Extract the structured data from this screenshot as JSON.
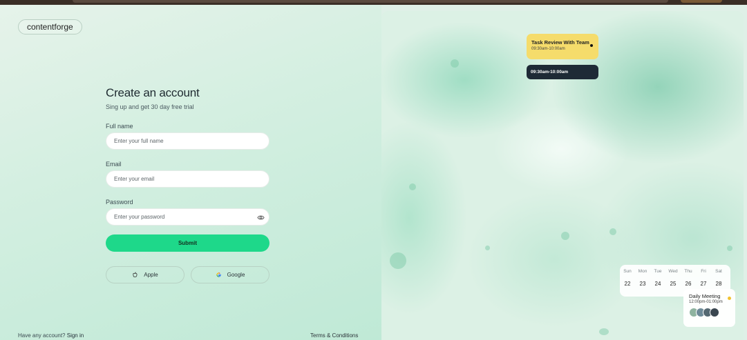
{
  "brand": {
    "logo": "contentforge"
  },
  "form": {
    "title": "Create an account",
    "subtitle": "Sing up and get 30 day free trial",
    "full_name_label": "Full name",
    "full_name_placeholder": "Enter your full name",
    "email_label": "Email",
    "email_placeholder": "Enter your email",
    "password_label": "Password",
    "password_placeholder": "Enter your password",
    "submit_label": "Submit",
    "apple_label": "Apple",
    "google_label": "Google"
  },
  "footer": {
    "signin_prompt": "Have any account?",
    "signin_link": "Sign in",
    "terms": "Terms & Conditions"
  },
  "preview": {
    "task_card": {
      "title": "Task Review With Team",
      "time": "09:30am-10:00am"
    },
    "time_card": {
      "time": "09:30am-10:00am"
    },
    "calendar": {
      "days": [
        "Sun",
        "Mon",
        "Tue",
        "Wed",
        "Thu",
        "Fri",
        "Sat"
      ],
      "dates": [
        "22",
        "23",
        "24",
        "25",
        "26",
        "27",
        "28"
      ]
    },
    "meeting": {
      "title": "Daily Meeting",
      "time": "12:00pm-01:00pm"
    }
  },
  "colors": {
    "accent": "#1ed88a",
    "task_card": "#f5dc6b",
    "time_card": "#1e2a36"
  }
}
